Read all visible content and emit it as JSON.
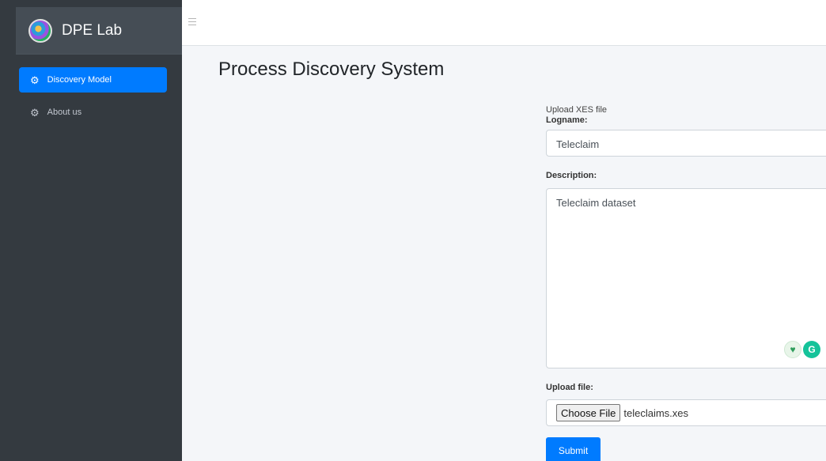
{
  "sidebar": {
    "brand": "DPE Lab",
    "items": [
      {
        "label": "Discovery Model",
        "icon": "gear-icon",
        "active": true
      },
      {
        "label": "About us",
        "icon": "gear-icon",
        "active": false
      }
    ]
  },
  "topbar": {
    "menu_icon": "hamburger-icon"
  },
  "main": {
    "title": "Process Discovery System",
    "form": {
      "hint": "Upload XES file",
      "logname_label": "Logname:",
      "logname_value": "Teleclaim",
      "description_label": "Description:",
      "description_value": "Teleclaim dataset",
      "upload_label": "Upload file:",
      "choose_file_label": "Choose File",
      "file_name": "teleclaims.xes",
      "submit_label": "Submit"
    }
  },
  "colors": {
    "sidebar_bg": "#343a40",
    "accent": "#007bff",
    "content_bg": "#f4f6f9"
  }
}
